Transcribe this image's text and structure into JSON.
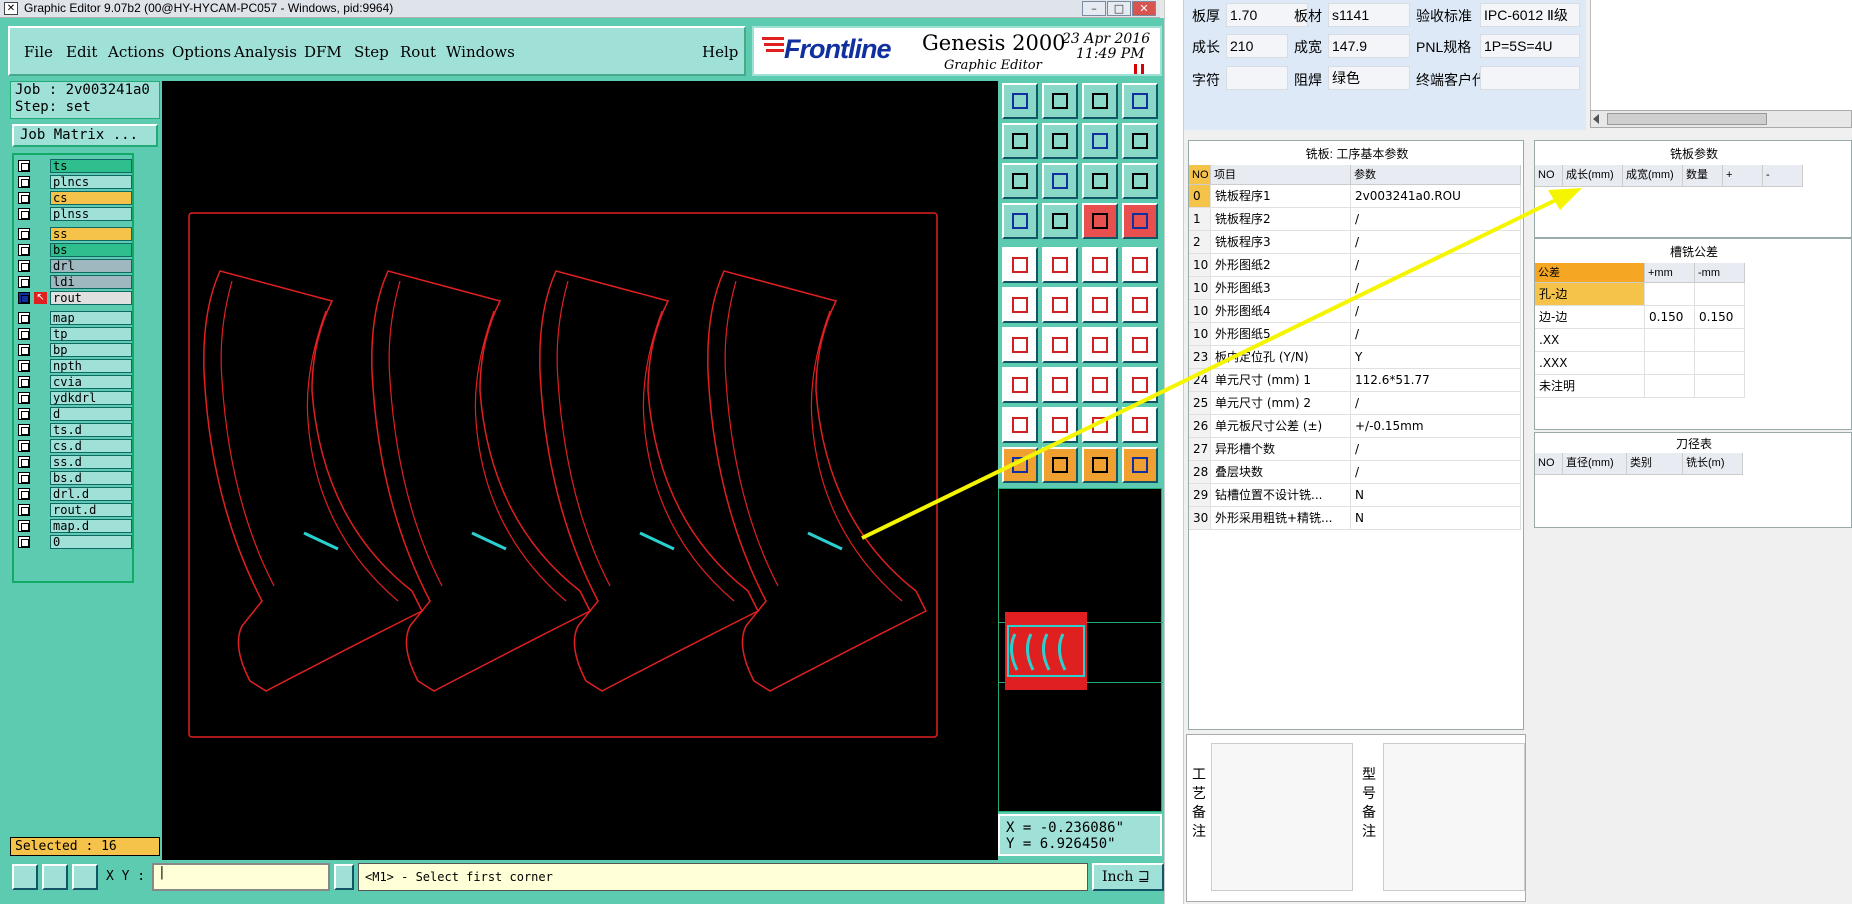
{
  "titlebar": {
    "text": "Graphic Editor 9.07b2 (00@HY-HYCAM-PC057 - Windows, pid:9964)"
  },
  "menu": {
    "items": [
      {
        "label": "File",
        "key": "F"
      },
      {
        "label": "Edit",
        "key": "E"
      },
      {
        "label": "Actions",
        "key": "A"
      },
      {
        "label": "Options",
        "key": "O"
      },
      {
        "label": "Analysis",
        "key": ""
      },
      {
        "label": "DFM",
        "key": ""
      },
      {
        "label": "Step",
        "key": "S"
      },
      {
        "label": "Rout",
        "key": "R"
      },
      {
        "label": "Windows",
        "key": "W"
      }
    ],
    "help": "Help"
  },
  "logo": {
    "brand": "Frontline",
    "product": "Genesis 2000",
    "subtitle": "Graphic Editor",
    "date": "23 Apr 2016",
    "time": "11:49 PM"
  },
  "job": {
    "job_line": "Job : 2v003241a0",
    "step_line": "Step: set",
    "matrix_button": "Job Matrix ..."
  },
  "layers": [
    {
      "name": "ts",
      "color": "#2fbf8f"
    },
    {
      "name": "plncs",
      "color": "#9fe0d7"
    },
    {
      "name": "cs",
      "color": "#f5c24a"
    },
    {
      "name": "plnss",
      "color": "#9fe0d7"
    },
    {
      "name": "ss",
      "color": "#f5c24a"
    },
    {
      "name": "bs",
      "color": "#2fbf8f"
    },
    {
      "name": "drl",
      "color": "#9fb8c0"
    },
    {
      "name": "ldi",
      "color": "#9fb8c0"
    },
    {
      "name": "rout",
      "color": "#e0e0e0"
    },
    {
      "name": "map",
      "color": "#9fe0d7"
    },
    {
      "name": "tp",
      "color": "#9fe0d7"
    },
    {
      "name": "bp",
      "color": "#9fe0d7"
    },
    {
      "name": "npth",
      "color": "#9fe0d7"
    },
    {
      "name": "cvia",
      "color": "#9fe0d7"
    },
    {
      "name": "ydkdrl",
      "color": "#9fe0d7"
    },
    {
      "name": "d",
      "color": "#9fe0d7"
    },
    {
      "name": "ts.d",
      "color": "#9fe0d7"
    },
    {
      "name": "cs.d",
      "color": "#9fe0d7"
    },
    {
      "name": "ss.d",
      "color": "#9fe0d7"
    },
    {
      "name": "bs.d",
      "color": "#9fe0d7"
    },
    {
      "name": "drl.d",
      "color": "#9fe0d7"
    },
    {
      "name": "rout.d",
      "color": "#9fe0d7"
    },
    {
      "name": "map.d",
      "color": "#9fe0d7"
    },
    {
      "name": "0",
      "color": "#9fe0d7"
    }
  ],
  "status": {
    "selected": "Selected : 16",
    "x": "X = -0.236086\"",
    "y": "Y =  6.926450\""
  },
  "command": {
    "xy_label": "X Y :",
    "message": "<M1> - Select first corner",
    "units": "Inch"
  },
  "toolbar_icons": [
    "snap-icon",
    "grid-icon",
    "home-icon",
    "layers-icon",
    "arrow-icon",
    "move-icon",
    "undo-icon",
    "redo-icon",
    "zoom-fit-icon",
    "pan-icon",
    "scale-icon",
    "help-icon",
    "select-icon",
    "grid2-icon",
    "net-icon",
    "net2-icon",
    "feature-icon",
    "copy-icon",
    "measure-icon",
    "circle-icon",
    "node-icon",
    "cross-icon",
    "line-icon",
    "pad-icon",
    "angle-icon",
    "slash-icon",
    "rotate-icon",
    "ff-icon",
    "box-icon",
    "bar-icon",
    "frame-icon",
    "shape-icon",
    "tri1-icon",
    "tri2-icon",
    "tri3-icon",
    "tri4-icon",
    "pointer1-icon",
    "pointer2-icon",
    "pointer3-icon",
    "pointer4-icon"
  ],
  "params": {
    "row1": [
      {
        "label": "板厚",
        "value": "1.70"
      },
      {
        "label": "板材",
        "value": "s1141"
      },
      {
        "label": "验收标准",
        "value": "IPC-6012 Ⅱ级"
      }
    ],
    "row2": [
      {
        "label": "成长",
        "value": "210"
      },
      {
        "label": "成宽",
        "value": "147.9"
      },
      {
        "label": "PNL规格",
        "value": "1P=5S=4U"
      }
    ],
    "row3": [
      {
        "label": "字符",
        "value": ""
      },
      {
        "label": "阻焊",
        "value": "绿色"
      },
      {
        "label": "终端客户代码",
        "value": ""
      }
    ]
  },
  "process_table": {
    "title": "铣板: 工序基本参数",
    "headers": [
      "NO",
      "项目",
      "参数"
    ],
    "rows": [
      [
        "0",
        "铣板程序1",
        "2v003241a0.ROU"
      ],
      [
        "1",
        "铣板程序2",
        "/"
      ],
      [
        "2",
        "铣板程序3",
        "/"
      ],
      [
        "10",
        "外形图纸2",
        "/"
      ],
      [
        "10",
        "外形图纸3",
        "/"
      ],
      [
        "10",
        "外形图纸4",
        "/"
      ],
      [
        "10",
        "外形图纸5",
        "/"
      ],
      [
        "23",
        "板内定位孔 (Y/N)",
        "Y"
      ],
      [
        "24",
        "单元尺寸 (mm) 1",
        "112.6*51.77"
      ],
      [
        "25",
        "单元尺寸 (mm) 2",
        "/"
      ],
      [
        "26",
        "单元板尺寸公差 (±)",
        "+/-0.15mm"
      ],
      [
        "27",
        "异形槽个数",
        "/"
      ],
      [
        "28",
        "叠层块数",
        "/"
      ],
      [
        "29",
        "钻槽位置不设计铣...",
        "N"
      ],
      [
        "30",
        "外形采用粗铣+精铣...",
        "N"
      ]
    ]
  },
  "mill_params": {
    "title": "铣板参数",
    "headers": [
      "NO",
      "成长(mm)",
      "成宽(mm)",
      "数量",
      "+",
      "-"
    ]
  },
  "slot_tol": {
    "title": "槽铣公差",
    "headers": [
      "公差",
      "+mm",
      "-mm"
    ],
    "rows": [
      [
        "孔-边",
        "",
        ""
      ],
      [
        "边-边",
        "0.150",
        "0.150"
      ],
      [
        ".XX",
        "",
        ""
      ],
      [
        ".XXX",
        "",
        ""
      ],
      [
        "未注明",
        "",
        ""
      ]
    ]
  },
  "tool_table": {
    "title": "刀径表",
    "headers": [
      "NO",
      "直径(mm)",
      "类别",
      "铣长(m)"
    ]
  },
  "notes": {
    "left": "工艺备注",
    "right": "型号备注"
  },
  "colors": {
    "accent_orange": "#f5a623",
    "rout_red": "#e02020",
    "arrow_yellow": "#f5f500"
  }
}
